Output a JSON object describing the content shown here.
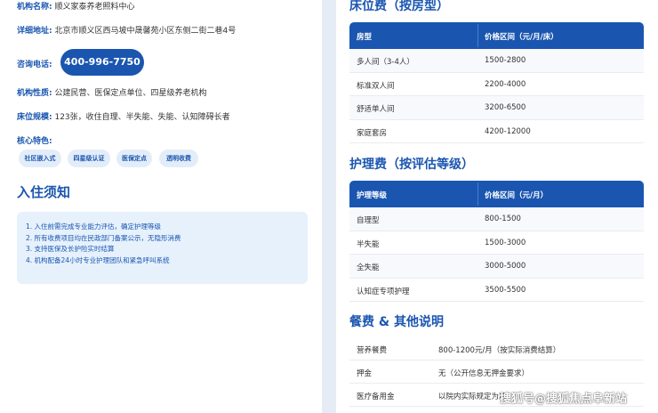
{
  "institution": {
    "name_label": "机构名称:",
    "name_value": "顺义家泰养老照料中心",
    "address_label": "详细地址:",
    "address_value": "北京市顺义区西马坡中晟馨苑小区东侧二街二巷4号",
    "phone_label": "咨询电话:",
    "phone_value": "400-996-7750",
    "nature_label": "机构性质:",
    "nature_value": "公建民营、医保定点单位、四星级养老机构",
    "scale_label": "床位规模:",
    "scale_value": "123张，收住自理、半失能、失能、认知障碍长者",
    "features_label": "核心特色:",
    "features": [
      "社区嵌入式",
      "四星级认证",
      "医保定点",
      "透明收费"
    ]
  },
  "notice": {
    "title": "入住须知",
    "items": [
      "1. 入住前需完成专业能力评估，确定护理等级",
      "2. 所有收费项目均在民政部门备案公示，无隐形消费",
      "3. 支持医保及长护险实时结算",
      "4. 机构配备24小时专业护理团队和紧急呼叫系统"
    ]
  },
  "bed_fee": {
    "title": "床位费（按房型）",
    "headers": [
      "房型",
      "价格区间（元/月/床）"
    ],
    "rows": [
      [
        "多人间（3-4人）",
        "1500-2800"
      ],
      [
        "标准双人间",
        "2200-4000"
      ],
      [
        "舒适单人间",
        "3200-6500"
      ],
      [
        "家庭套房",
        "4200-12000"
      ]
    ]
  },
  "care_fee": {
    "title": "护理费（按评估等级）",
    "headers": [
      "护理等级",
      "价格区间（元/月）"
    ],
    "rows": [
      [
        "自理型",
        "800-1500"
      ],
      [
        "半失能",
        "1500-3000"
      ],
      [
        "全失能",
        "3000-5000"
      ],
      [
        "认知症专项护理",
        "3500-5500"
      ]
    ]
  },
  "other": {
    "title": "餐费 & 其他说明",
    "rows": [
      [
        "营养餐费",
        "800-1200元/月（按实际消费结算）"
      ],
      [
        "押金",
        "无（公开信息无押金要求）"
      ],
      [
        "医疗备用金",
        "以院内实际规定为准"
      ]
    ]
  },
  "watermark": "搜狐号@搜狐焦点阜新站",
  "colors": {
    "primary": "#1a56b0",
    "tag_bg": "#e3edf9",
    "notice_bg": "#e6f1fc"
  }
}
